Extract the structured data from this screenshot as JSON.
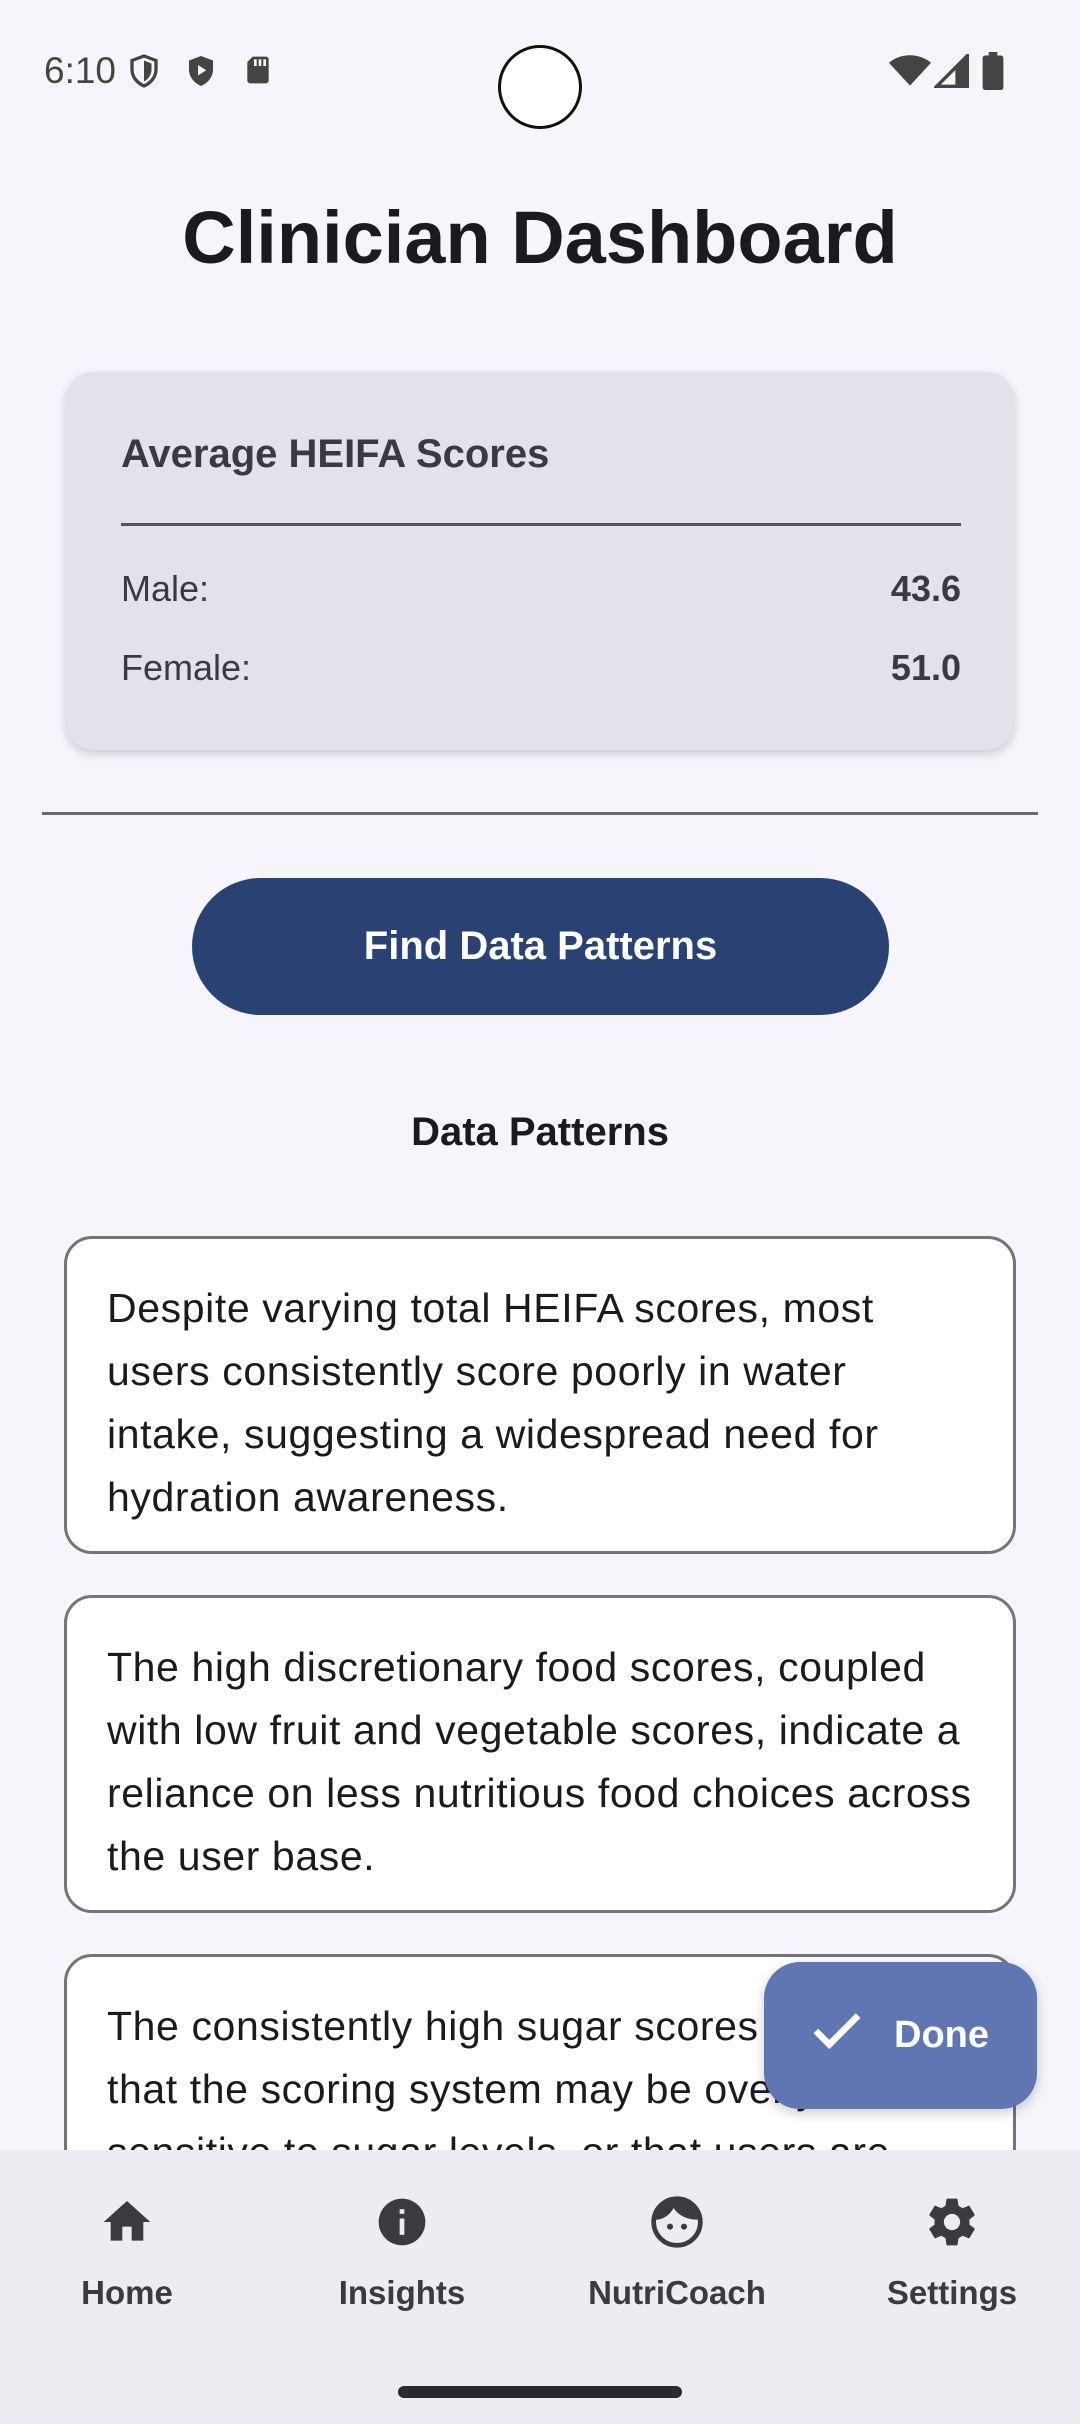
{
  "status_bar": {
    "time": "6:10"
  },
  "header": {
    "title": "Clinician Dashboard"
  },
  "scores_card": {
    "title": "Average HEIFA Scores",
    "rows": [
      {
        "label": "Male:",
        "value": "43.6"
      },
      {
        "label": "Female:",
        "value": "51.0"
      }
    ]
  },
  "actions": {
    "find_patterns_label": "Find Data Patterns"
  },
  "patterns": {
    "heading": "Data Patterns",
    "items": [
      "Despite varying total HEIFA scores, most users consistently score poorly in water intake, suggesting a widespread need for hydration awareness.",
      "The high discretionary food scores, coupled with low fruit and vegetable scores, indicate a reliance on less nutritious food choices across the user base.",
      "The consistently high sugar scores suggest that the scoring system may be overly sensitive to sugar levels, or that users are"
    ]
  },
  "fab": {
    "label": "Done"
  },
  "bottom_nav": {
    "items": [
      {
        "label": "Home",
        "icon": "home-icon"
      },
      {
        "label": "Insights",
        "icon": "info-icon"
      },
      {
        "label": "NutriCoach",
        "icon": "face-icon"
      },
      {
        "label": "Settings",
        "icon": "gear-icon"
      }
    ]
  }
}
